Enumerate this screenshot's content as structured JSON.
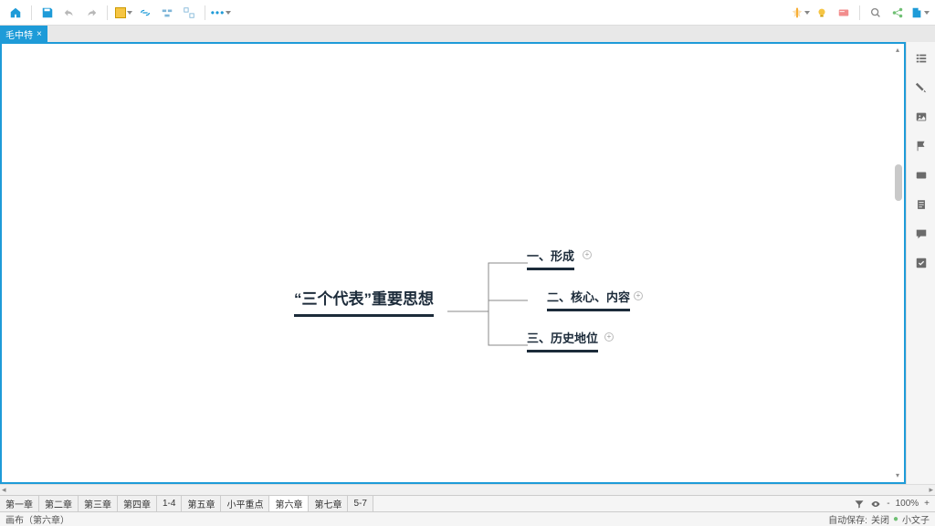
{
  "toolbar": {
    "home_icon": "home-icon",
    "save_icon": "save-icon",
    "undo_icon": "undo-icon",
    "redo_icon": "redo-icon",
    "color_icon": "palette-icon",
    "link_icon": "link-icon",
    "group_icon": "group-icon",
    "ungroup_icon": "ungroup-icon",
    "more_icon": "more-icon",
    "marker_icon": "marker-icon",
    "idea_icon": "lightbulb-icon",
    "card_icon": "card-icon",
    "search_icon": "search-icon",
    "share_icon": "share-icon",
    "export_icon": "export-icon"
  },
  "tab": {
    "title": "毛中特",
    "close": "×"
  },
  "mindmap": {
    "root": "“三个代表”重要思想",
    "children": [
      {
        "label": "一、形成"
      },
      {
        "label": "二、核心、内容"
      },
      {
        "label": "三、历史地位"
      }
    ],
    "expand_marker": "+"
  },
  "right_panel": {
    "items": [
      "outline-icon",
      "format-icon",
      "image-icon",
      "flag-icon",
      "node-icon",
      "note-icon",
      "comment-icon",
      "task-icon"
    ]
  },
  "sheets": [
    "第一章",
    "第二章",
    "第三章",
    "第四章",
    "1-4",
    "第五章",
    "小平重点",
    "第六章",
    "第七章",
    "5-7"
  ],
  "sheet_active_index": 7,
  "sheet_tools": {
    "zoom": "100%",
    "zoom_minus": "-",
    "zoom_plus": "+"
  },
  "statusbar": {
    "left": "画布（第六章）",
    "autosave_label": "自动保存:",
    "autosave_state": "关闭",
    "user": "小文子"
  },
  "colors": {
    "accent": "#1e9bd8",
    "node": "#1c2b3a",
    "marker": "#f6a623",
    "bulb": "#f6c543"
  }
}
